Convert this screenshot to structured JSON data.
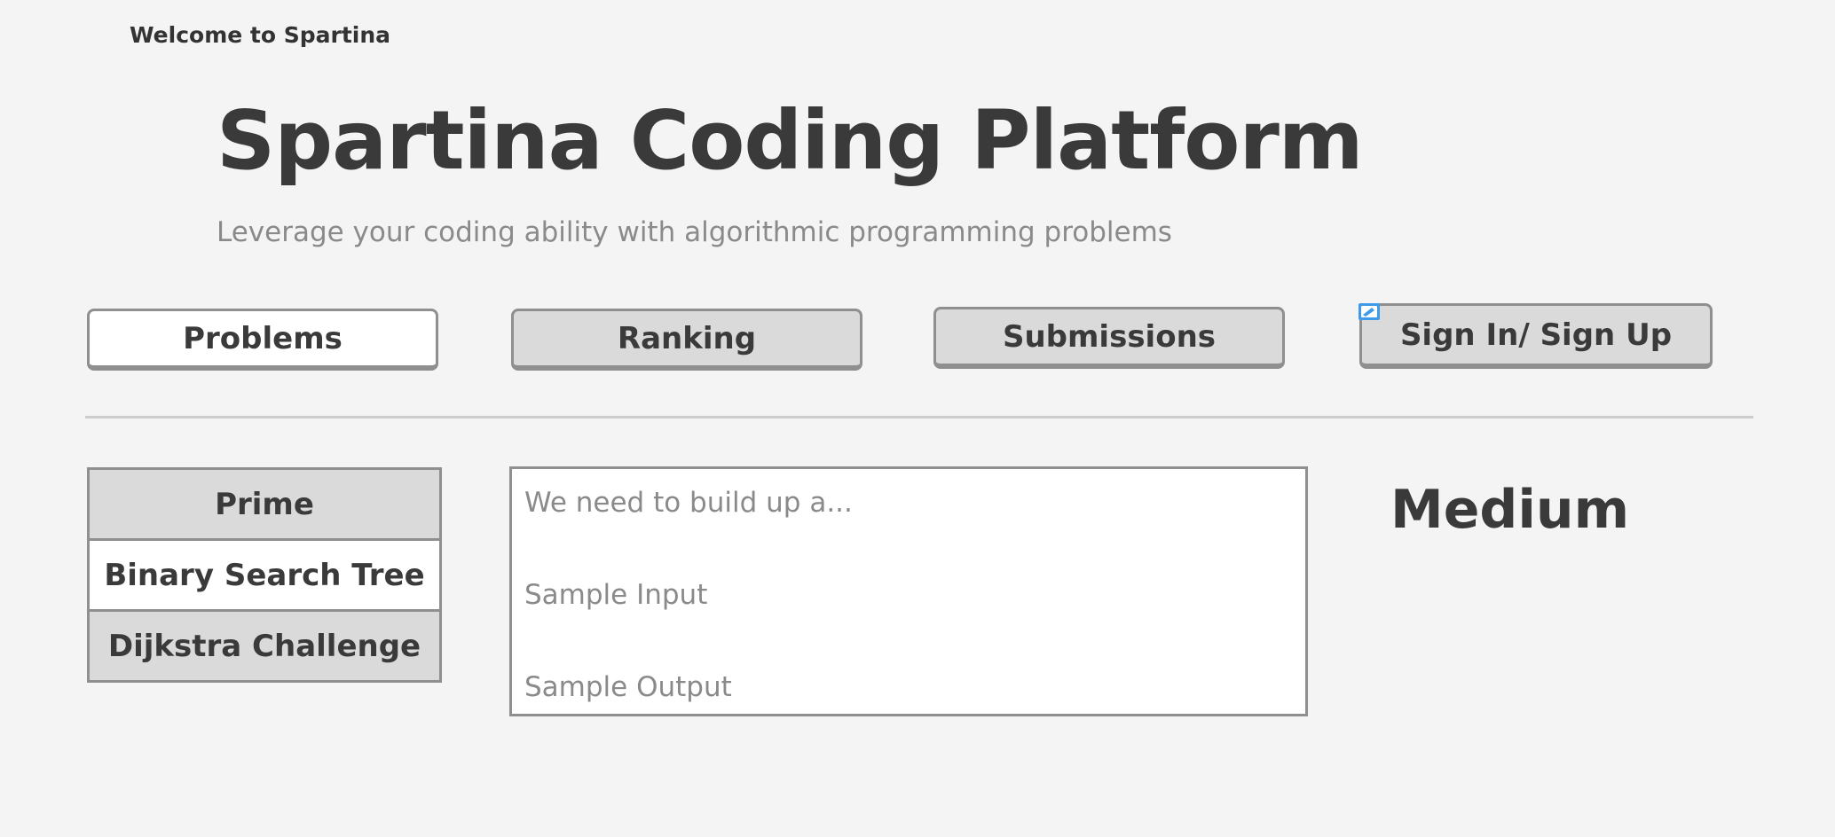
{
  "header": {
    "welcome": "Welcome to Spartina",
    "title": "Spartina Coding Platform",
    "subtitle": "Leverage your coding ability with algorithmic programming problems"
  },
  "nav": {
    "problems_label": "Problems",
    "ranking_label": "Ranking",
    "submissions_label": "Submissions",
    "signin_label": "Sign In/ Sign Up",
    "active": "Problems",
    "edit_icon": "edit-icon"
  },
  "problems": {
    "items": [
      "Prime",
      "Binary Search Tree",
      "Dijkstra Challenge"
    ],
    "selected": "Binary Search Tree"
  },
  "detail": {
    "description": "We need to build up a...",
    "sample_input_label": "Sample Input",
    "sample_output_label": "Sample Output",
    "difficulty": "Medium"
  },
  "colors": {
    "background": "#f4f4f4",
    "button_fill": "#dadada",
    "active_fill": "#ffffff",
    "border": "#8f8f8f",
    "text_dark": "#3a3a3a",
    "text_muted": "#8a8a8a",
    "edit_icon_accent": "#3d9be9"
  }
}
